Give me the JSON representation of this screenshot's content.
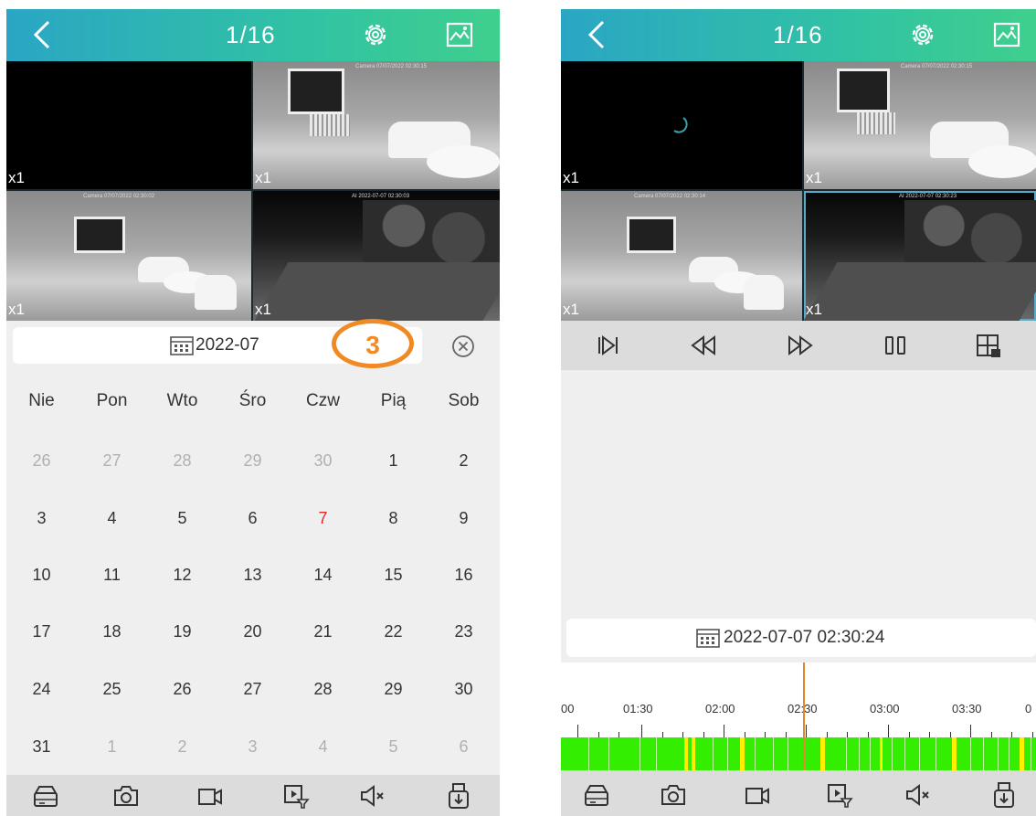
{
  "left": {
    "title": "1/16",
    "cameras": [
      {
        "zoom": "x1",
        "osd": ""
      },
      {
        "zoom": "x1",
        "osd": "Camera   07/07/2022 02:30:15"
      },
      {
        "zoom": "x1",
        "osd": "Camera   07/07/2022 02:30:02"
      },
      {
        "zoom": "x1",
        "osd": "AI   2022-07-07 02:30:03"
      }
    ],
    "calendar": {
      "month": "2022-07",
      "badge": "3",
      "weekdays": [
        "Nie",
        "Pon",
        "Wto",
        "Śro",
        "Czw",
        "Pią",
        "Sob"
      ],
      "rows": [
        [
          "26",
          "27",
          "28",
          "29",
          "30",
          "1",
          "2"
        ],
        [
          "3",
          "4",
          "5",
          "6",
          "7",
          "8",
          "9"
        ],
        [
          "10",
          "11",
          "12",
          "13",
          "14",
          "15",
          "16"
        ],
        [
          "17",
          "18",
          "19",
          "20",
          "21",
          "22",
          "23"
        ],
        [
          "24",
          "25",
          "26",
          "27",
          "28",
          "29",
          "30"
        ],
        [
          "31",
          "1",
          "2",
          "3",
          "4",
          "5",
          "6"
        ]
      ],
      "today": "7"
    }
  },
  "right": {
    "title": "1/16",
    "cameras": [
      {
        "zoom": "x1",
        "osd": ""
      },
      {
        "zoom": "x1",
        "osd": "Camera   07/07/2022 02:30:15"
      },
      {
        "zoom": "x1",
        "osd": "Camera   07/07/2022 02:30:14"
      },
      {
        "zoom": "x1",
        "osd": "AI   2022-07-07 02:30:23"
      }
    ],
    "datetime": "2022-07-07 02:30:24",
    "timeline": {
      "labels": [
        "00",
        "01:30",
        "02:00",
        "02:30",
        "03:00",
        "03:30",
        "0"
      ]
    }
  },
  "colors": {
    "accent_start": "#2aa6c4",
    "accent_end": "#3fcf8d",
    "badge": "#f08a24",
    "today": "#e02828",
    "recording": "#33ee00",
    "alarm": "#ffee00",
    "cursor": "#e08a2a"
  },
  "icons": [
    "back-arrow-icon",
    "gear-icon",
    "image-icon",
    "calendar-icon",
    "close-circle-icon",
    "storage-icon",
    "camera-icon",
    "video-icon",
    "filter-playback-icon",
    "mute-icon",
    "download-icon",
    "step-forward-icon",
    "rewind-icon",
    "fast-forward-icon",
    "pause-icon",
    "layout-grid-icon"
  ]
}
